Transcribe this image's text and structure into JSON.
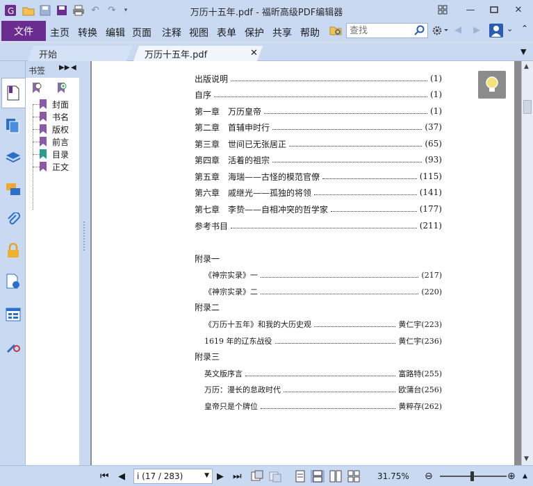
{
  "window": {
    "title": "万历十五年.pdf - 福昕高级PDF编辑器",
    "controls": [
      "restore-icon",
      "minimize-icon",
      "maximize-icon",
      "close-icon"
    ]
  },
  "quick_access": [
    "app-logo-icon",
    "open-icon",
    "save-icon",
    "save-as-icon",
    "print-icon",
    "undo-icon",
    "redo-icon",
    "customize-icon"
  ],
  "menu": {
    "file": "文件",
    "items": [
      "主页",
      "转换",
      "编辑",
      "页面",
      "注释",
      "视图",
      "表单",
      "保护",
      "共享",
      "帮助"
    ],
    "search_placeholder": "查找"
  },
  "tabs": {
    "start": "开始",
    "document": "万历十五年.pdf"
  },
  "bookmark_panel": {
    "title": "书签",
    "items": [
      "封面",
      "书名",
      "版权",
      "前言",
      "目录",
      "正文"
    ]
  },
  "toc": {
    "entries": [
      {
        "label": "出版说明",
        "page": "(1)"
      },
      {
        "label": "自序",
        "page": "(1)"
      },
      {
        "label": "第一章　万历皇帝",
        "page": "(1)"
      },
      {
        "label": "第二章　首辅申时行",
        "page": "(37)"
      },
      {
        "label": "第三章　世间已无张居正",
        "page": "(65)"
      },
      {
        "label": "第四章　活着的祖宗",
        "page": "(93)"
      },
      {
        "label": "第五章　海瑞——古怪的模范官僚",
        "page": "(115)"
      },
      {
        "label": "第六章　戚继光——孤独的将领",
        "page": "(141)"
      },
      {
        "label": "第七章　李贽——自相冲突的哲学家",
        "page": "(177)"
      },
      {
        "label": "参考书目",
        "page": "(211)"
      }
    ],
    "appendix1": {
      "title": "附录一",
      "entries": [
        {
          "label": "《神宗实录》一",
          "page": "(217)"
        },
        {
          "label": "《神宗实录》二",
          "page": "(220)"
        }
      ]
    },
    "appendix2": {
      "title": "附录二",
      "entries": [
        {
          "label": "《万历十五年》和我的大历史观",
          "page": "黄仁宇(223)"
        },
        {
          "label": "1619 年的辽东战役",
          "page": "黄仁宇(236)"
        }
      ]
    },
    "appendix3": {
      "title": "附录三",
      "entries": [
        {
          "label": "英文版序言",
          "page": "富路特(255)"
        },
        {
          "label": "万历：漫长的怠政时代",
          "page": "欧蒲台(256)"
        },
        {
          "label": "皇帝只是个牌位",
          "page": "黄粹存(262)"
        }
      ]
    }
  },
  "status": {
    "page_indicator": "i (17 / 283)",
    "zoom": "31.75%"
  },
  "colors": {
    "chrome": "#c9d9f2",
    "file_menu": "#6a2d8f",
    "doc_background": "#8c8c8c"
  }
}
